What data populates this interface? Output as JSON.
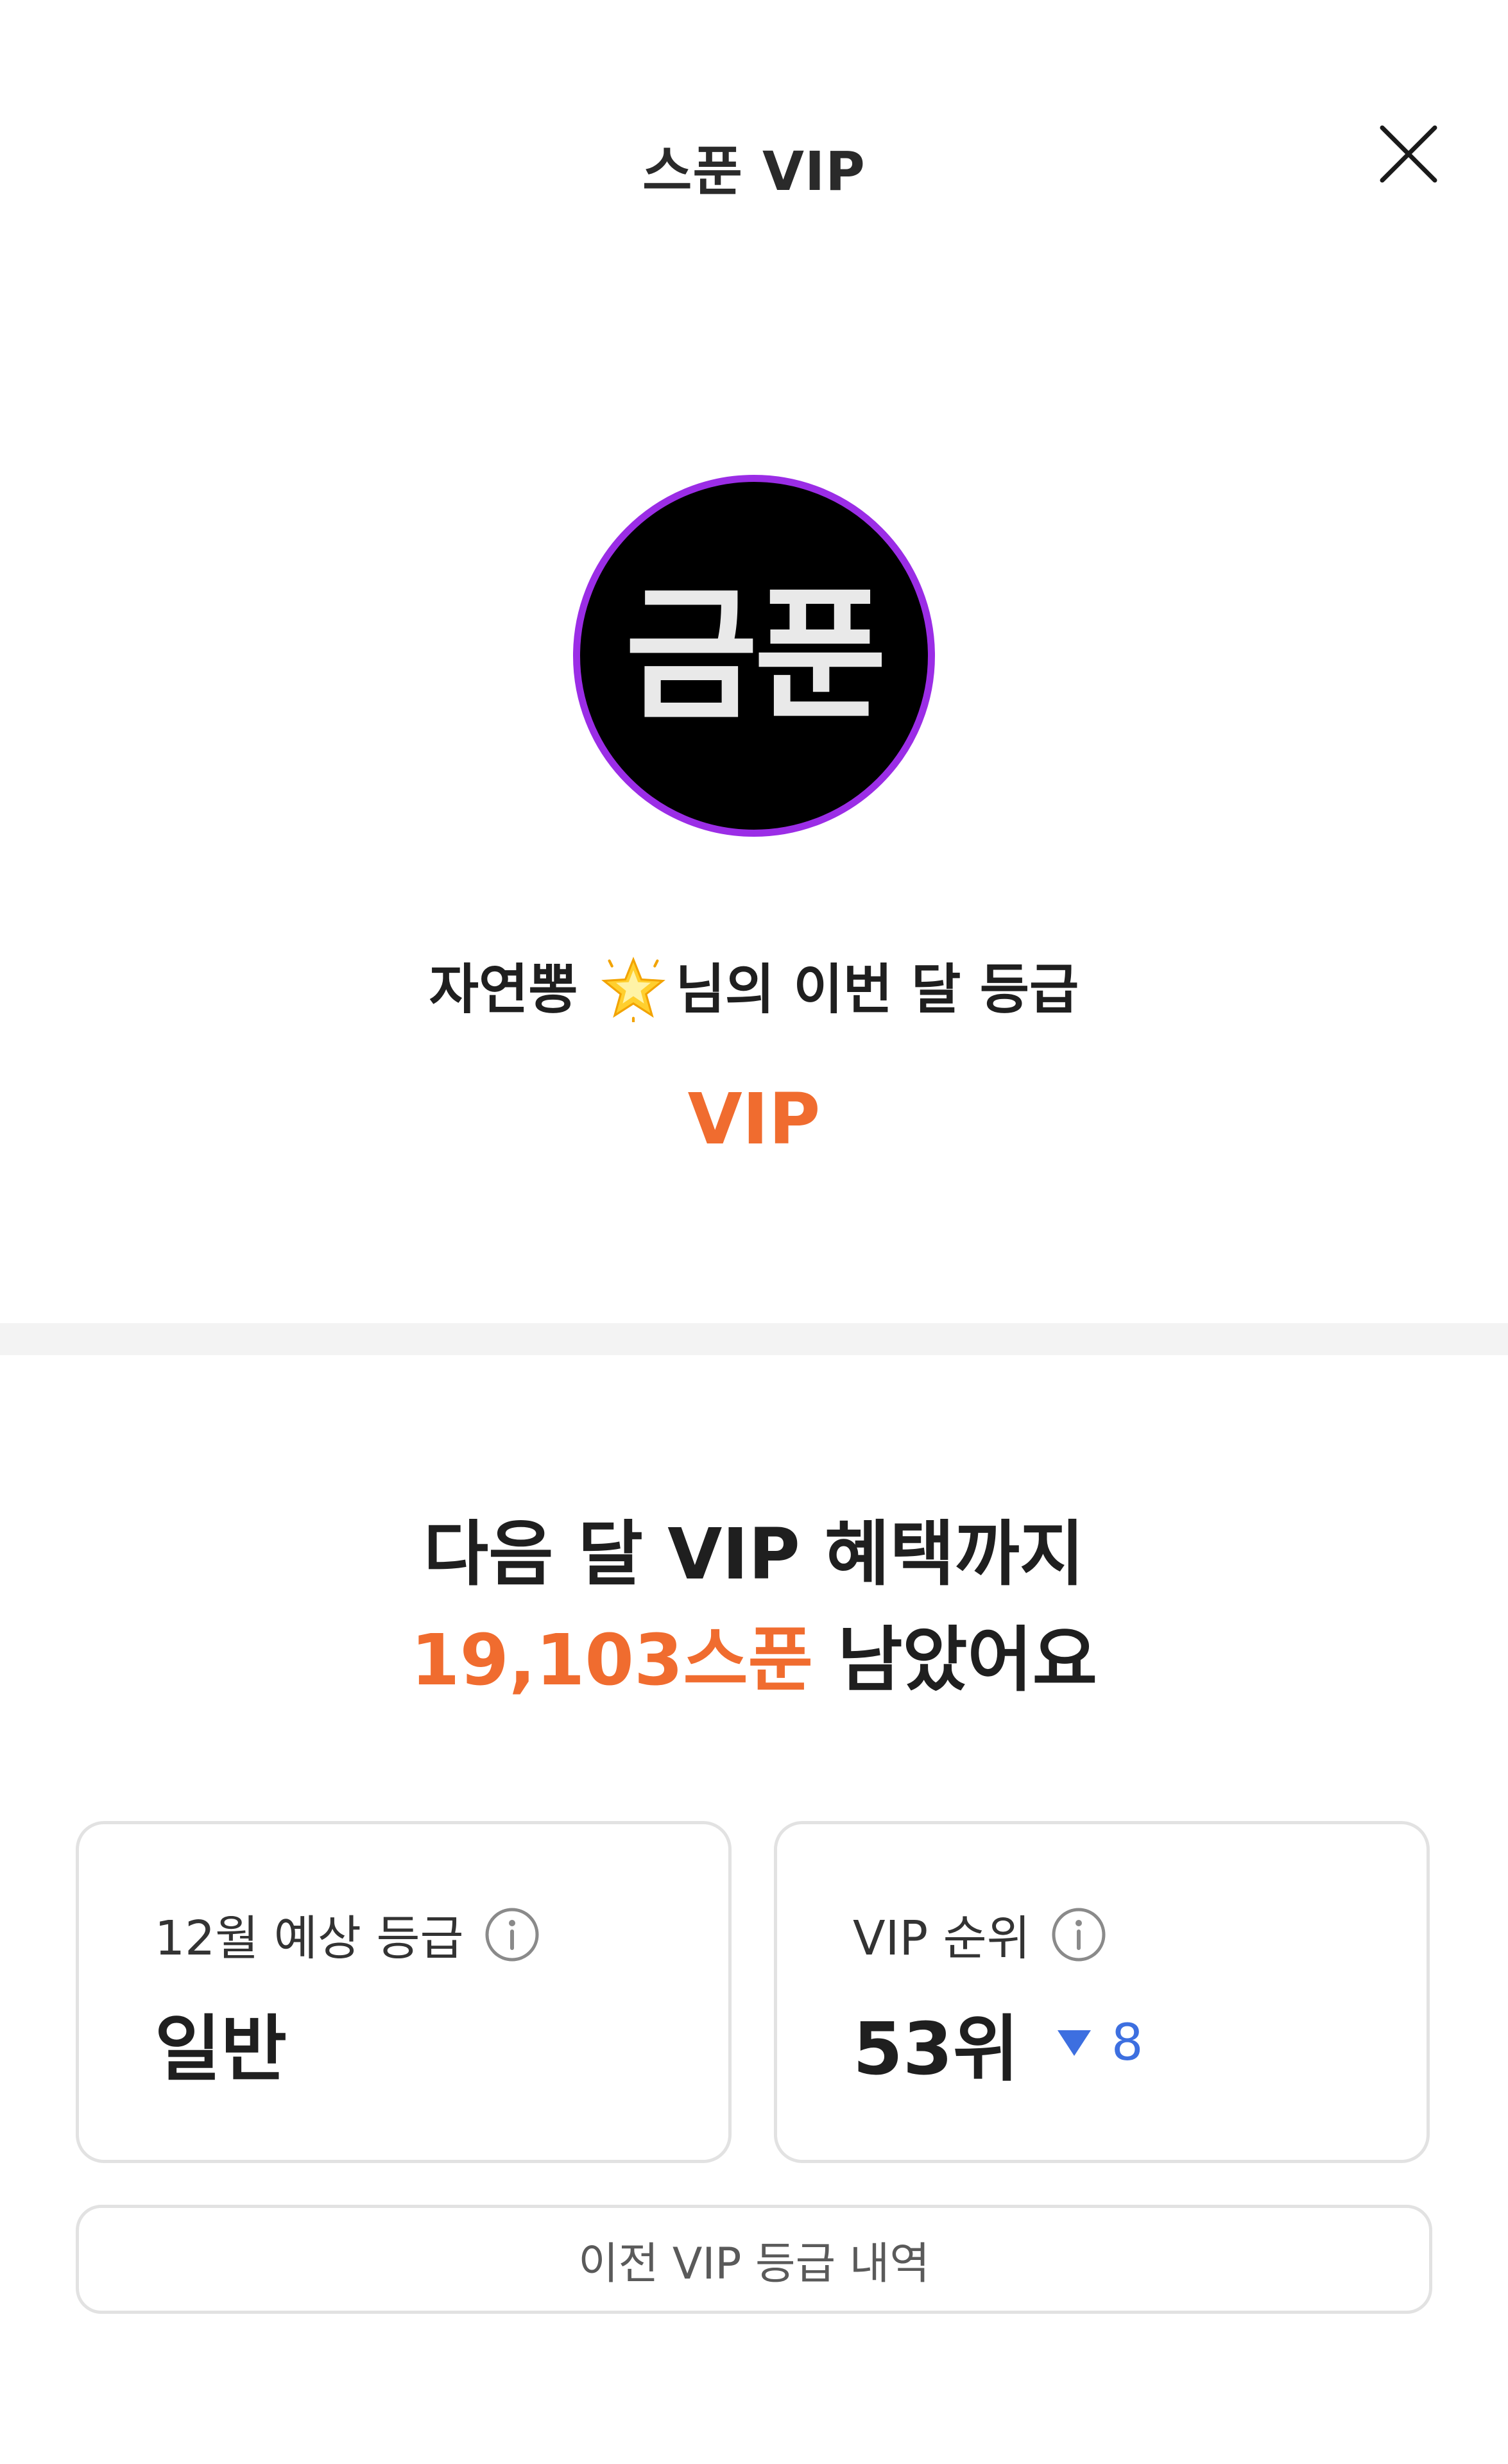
{
  "header": {
    "title": "스푼 VIP",
    "close_icon": "close-icon"
  },
  "profile": {
    "avatar_text": "금푼",
    "avatar_border_color": "#9b2de6",
    "nickname": "자연뽕",
    "nickname_icon": "sparkle-star-icon",
    "grade_suffix": "님의 이번 달 등급",
    "current_grade": "VIP",
    "accent_color": "#f06c2f"
  },
  "progress": {
    "headline_line1": "다음 달 VIP 혜택까지",
    "remaining_amount": "19,103스푼",
    "remaining_suffix": "남았어요"
  },
  "cards": {
    "expected_grade": {
      "label": "12월 예상 등급",
      "value": "일반",
      "icon": "info-icon"
    },
    "vip_rank": {
      "label": "VIP 순위",
      "value": "53위",
      "change": "8",
      "change_direction": "down",
      "change_color": "#3d6fe0",
      "icon": "info-icon"
    }
  },
  "history_button": {
    "label": "이전 VIP 등급 내역"
  }
}
